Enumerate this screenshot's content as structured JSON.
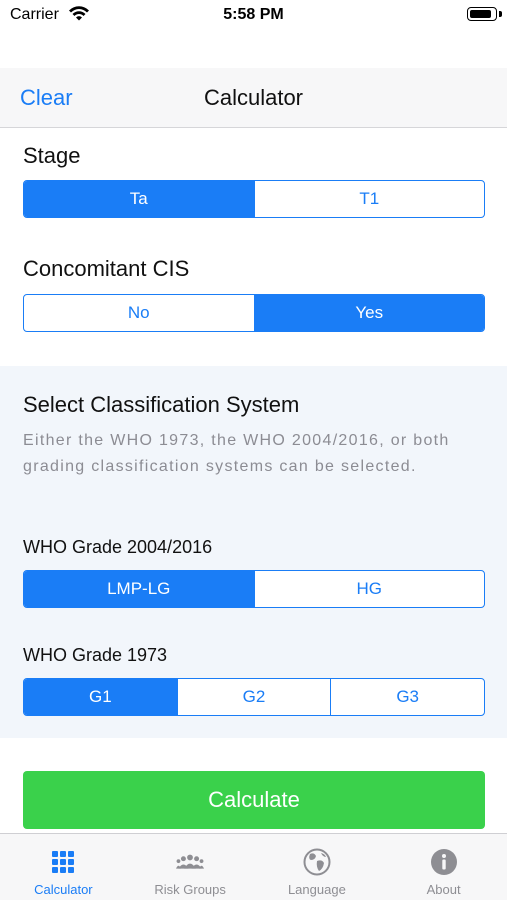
{
  "status_bar": {
    "carrier": "Carrier",
    "time": "5:58 PM",
    "battery_level": 0.9
  },
  "nav": {
    "clear_label": "Clear",
    "title": "Calculator"
  },
  "stage": {
    "label": "Stage",
    "options": [
      "Ta",
      "T1"
    ],
    "selected": "Ta"
  },
  "cis": {
    "label": "Concomitant CIS",
    "options": [
      "No",
      "Yes"
    ],
    "selected": "Yes"
  },
  "classification": {
    "title": "Select Classification System",
    "description": "Either the WHO 1973, the WHO 2004/2016, or both grading classification systems can be selected."
  },
  "who2004": {
    "label": "WHO Grade 2004/2016",
    "options": [
      "LMP-LG",
      "HG"
    ],
    "selected": "LMP-LG"
  },
  "who1973": {
    "label": "WHO Grade 1973",
    "options": [
      "G1",
      "G2",
      "G3"
    ],
    "selected": "G1"
  },
  "calculate_label": "Calculate",
  "tabs": [
    {
      "label": "Calculator",
      "icon": "grid-icon",
      "active": true
    },
    {
      "label": "Risk Groups",
      "icon": "people-icon",
      "active": false
    },
    {
      "label": "Language",
      "icon": "globe-icon",
      "active": false
    },
    {
      "label": "About",
      "icon": "info-icon",
      "active": false
    }
  ],
  "colors": {
    "accent": "#1a7df6",
    "calculate": "#3ad14b",
    "panel": "#f2f6fb",
    "inactive_tab": "#8e8e93"
  }
}
